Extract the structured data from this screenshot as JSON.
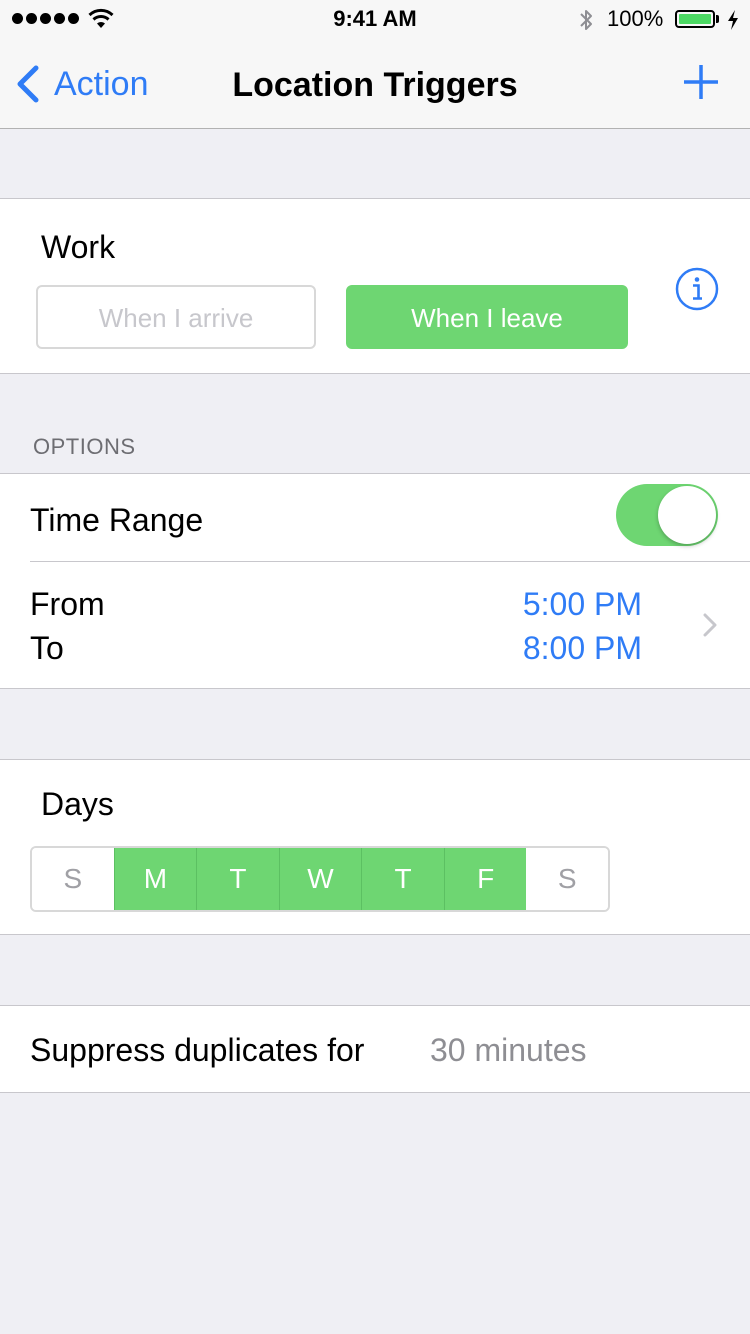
{
  "status_bar": {
    "time": "9:41 AM",
    "battery_percent": "100%",
    "signal_bars": 5,
    "battery_level": 1.0,
    "charging": true,
    "icons": [
      "wifi-icon",
      "bluetooth-icon",
      "battery-icon",
      "charging-icon"
    ]
  },
  "nav": {
    "back_label": "Action",
    "title": "Location Triggers",
    "add_icon": "plus-icon"
  },
  "work": {
    "title": "Work",
    "arrive_label": "When I arrive",
    "leave_label": "When I leave",
    "selected": "leave",
    "info_icon": "info-icon"
  },
  "options": {
    "header": "OPTIONS",
    "time_range_label": "Time Range",
    "time_range_enabled": true,
    "from_label": "From",
    "from_value": "5:00 PM",
    "to_label": "To",
    "to_value": "8:00 PM"
  },
  "days": {
    "title": "Days",
    "items": [
      {
        "label": "S",
        "active": false
      },
      {
        "label": "M",
        "active": true
      },
      {
        "label": "T",
        "active": true
      },
      {
        "label": "W",
        "active": true
      },
      {
        "label": "T",
        "active": true
      },
      {
        "label": "F",
        "active": true
      },
      {
        "label": "S",
        "active": false
      }
    ]
  },
  "suppress": {
    "label": "Suppress duplicates for",
    "value": "30 minutes"
  },
  "colors": {
    "accent_blue": "#2F7CF6",
    "active_green": "#6ED672",
    "background": "#EFEFF4",
    "secondary_text": "#8E8E93"
  }
}
